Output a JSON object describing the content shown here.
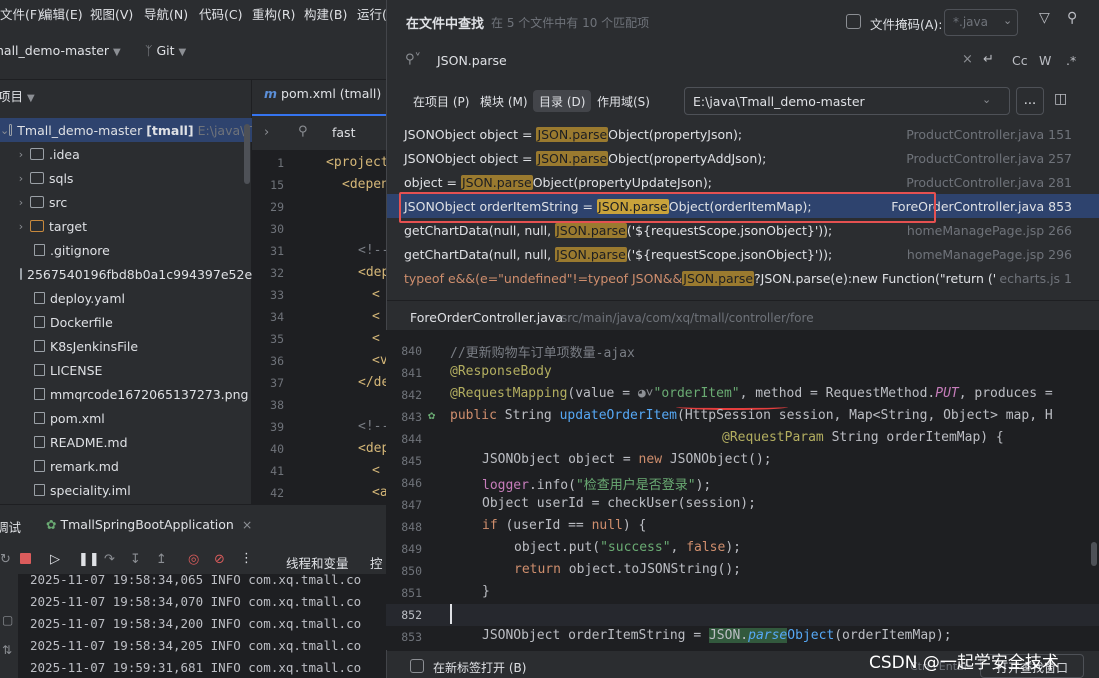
{
  "menu": [
    "文件(F)",
    "编辑(E)",
    "视图(V)",
    "导航(N)",
    "代码(C)",
    "重构(R)",
    "构建(B)",
    "运行("
  ],
  "toolbar": {
    "project_name": "nall_demo-master",
    "vcs": "Git"
  },
  "project_panel": {
    "title": "项目",
    "root": {
      "name": "Tmall_demo-master",
      "module": "[tmall]",
      "path": "E:\\java\\T"
    },
    "items": [
      {
        "label": ".idea",
        "kind": "folder"
      },
      {
        "label": "sqls",
        "kind": "folder"
      },
      {
        "label": "src",
        "kind": "folder"
      },
      {
        "label": "target",
        "kind": "folder-orange"
      },
      {
        "label": ".gitignore",
        "kind": "file"
      },
      {
        "label": "2567540196fbd8b0a1c994397e52e",
        "kind": "file"
      },
      {
        "label": "deploy.yaml",
        "kind": "file"
      },
      {
        "label": "Dockerfile",
        "kind": "file"
      },
      {
        "label": "K8sJenkinsFile",
        "kind": "file"
      },
      {
        "label": "LICENSE",
        "kind": "file"
      },
      {
        "label": "mmqrcode1672065137273.png",
        "kind": "file"
      },
      {
        "label": "pom.xml",
        "kind": "file"
      },
      {
        "label": "README.md",
        "kind": "file"
      },
      {
        "label": "remark.md",
        "kind": "file"
      },
      {
        "label": "speciality.iml",
        "kind": "file"
      }
    ]
  },
  "editor": {
    "tab": "pom.xml (tmall)",
    "search_text": "fast",
    "line_numbers": [
      "1",
      "15",
      "29",
      "30",
      "31",
      "32",
      "33",
      "34",
      "35",
      "36",
      "37",
      "38",
      "39",
      "40",
      "41",
      "42",
      "43"
    ],
    "snippets": [
      "<project",
      "<depen",
      "<!--",
      "<dep",
      "<",
      "<",
      "<",
      "<v",
      "</de",
      "<!--",
      "<dep",
      "<",
      "<a"
    ]
  },
  "run_panel": {
    "title": "调试",
    "config": "TmallSpringBootApplication",
    "tabs": [
      "线程和变量",
      "控"
    ],
    "log_lines": [
      "2025-11-07 19:58:34,065 INFO  com.xq.tmall.co",
      "2025-11-07 19:58:34,070 INFO  com.xq.tmall.co",
      "2025-11-07 19:58:34,200 INFO  com.xq.tmall.co",
      "2025-11-07 19:58:34,205 INFO  com.xq.tmall.co",
      "2025-11-07 19:59:31,681 INFO  com.xq.tmall.co"
    ]
  },
  "find": {
    "title": "在文件中查找",
    "summary": "在 5 个文件中有 10 个匹配项",
    "file_mask_label": "文件掩码(A):",
    "file_mask_value": "*.java",
    "query": "JSON.parse",
    "opts": [
      "Cc",
      "W",
      ".*"
    ],
    "scopes": [
      "在项目 (P)",
      "模块 (M)",
      "目录 (D)",
      "作用域(S)"
    ],
    "directory": "E:\\java\\Tmall_demo-master",
    "browse": "...",
    "results": [
      {
        "pre": "JSONObject object = ",
        "match": "JSON.parse",
        "post": "Object(propertyJson);",
        "where": "ProductController.java 151"
      },
      {
        "pre": "JSONObject object = ",
        "match": "JSON.parse",
        "post": "Object(propertyAddJson);",
        "where": "ProductController.java 257"
      },
      {
        "pre": "object = ",
        "match": "JSON.parse",
        "post": "Object(propertyUpdateJson);",
        "where": "ProductController.java 281"
      },
      {
        "pre": "JSONObject orderItemString = ",
        "match": "JSON.parse",
        "post": "Object(orderItemMap);",
        "where": "ForeOrderController.java 853"
      },
      {
        "pre": "getChartData(null, null, ",
        "match": "JSON.parse",
        "post": "('${requestScope.jsonObject}'));",
        "where": "homeManagePage.jsp 266"
      },
      {
        "pre": "getChartData(null, null, ",
        "match": "JSON.parse",
        "post": "('${requestScope.jsonObject}'));",
        "where": "homeManagePage.jsp 296"
      },
      {
        "pre": "typeof e&&(e=\"undefined\"!=typeof JSON&&",
        "match": "JSON.parse",
        "post": "?JSON.parse(e):new Function(\"return (\"+e+\");\"",
        "where": "echarts.js 1"
      }
    ],
    "selected_index": 3,
    "preview_file": "ForeOrderController.java",
    "preview_path": "src/main/java/com/xq/tmall/controller/fore",
    "open_in_tab": "在新标签打开 (B)",
    "open_window": "打开查找窗口",
    "shortcut": "Ctrl+Enter"
  },
  "preview": {
    "line_numbers": [
      "840",
      "841",
      "842",
      "843",
      "844",
      "845",
      "846",
      "847",
      "848",
      "849",
      "850",
      "851",
      "852",
      "853"
    ],
    "comment_840": "//更新购物车订单项数量-ajax",
    "ann_841": "@ResponseBody",
    "l842_a": "@RequestMapping",
    "l842_b": "(value = ",
    "l842_str": "\"orderItem\"",
    "l842_c": ", method = RequestMethod.",
    "l842_put": "PUT",
    "l842_d": ", produces =",
    "l843_kw": "public ",
    "l843_a": "String ",
    "l843_fn": "updateOrderItem",
    "l843_b": "(HttpSession session, Map<String, Object> map, H",
    "l844_ann": "@RequestParam",
    "l844_b": " String orderItemMap) {",
    "l845_a": "JSONObject object = ",
    "l845_kw": "new ",
    "l845_b": "JSONObject();",
    "l846_f": "logger",
    "l846_a": ".info(",
    "l846_str": "\"检查用户是否登录\"",
    "l846_b": ");",
    "l847": "Object userId = checkUser(session);",
    "l848_kw": "if ",
    "l848_a": "(userId == ",
    "l848_null": "null",
    "l848_b": ") {",
    "l849_a": "object.put(",
    "l849_str": "\"success\"",
    "l849_b": ", ",
    "l849_false": "false",
    "l849_c": ");",
    "l850_kw": "return ",
    "l850_a": "object.toJSONString();",
    "l851": "}",
    "l853_a": "JSONObject orderItemString = ",
    "l853_m": "JSON.",
    "l853_it": "parse",
    "l853_b": "Object",
    "l853_c": "(orderItemMap);"
  },
  "watermark": "CSDN @一起学安全技术"
}
